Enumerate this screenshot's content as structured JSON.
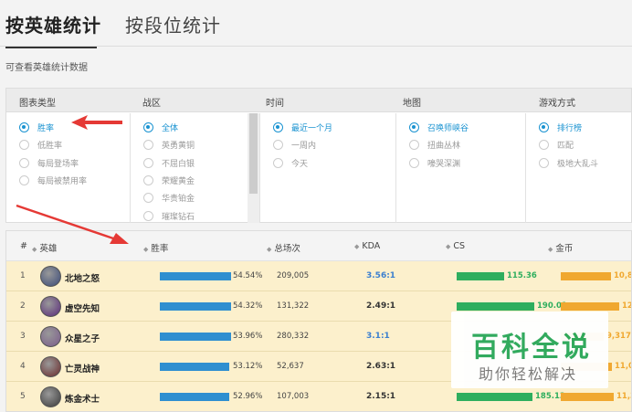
{
  "tabs": [
    "按英雄统计",
    "按段位统计"
  ],
  "description": "可查看英雄统计数据",
  "filters": [
    {
      "header": "图表类型",
      "options": [
        "胜率",
        "低胜率",
        "每局登场率",
        "每局被禁用率"
      ],
      "selected": 0
    },
    {
      "header": "战区",
      "options": [
        "全体",
        "英勇黄铜",
        "不屈白银",
        "荣耀黄金",
        "华贵铂金",
        "璀璨钻石"
      ],
      "selected": 0
    },
    {
      "header": "时间",
      "options": [
        "最近一个月",
        "一周内",
        "今天"
      ],
      "selected": 0
    },
    {
      "header": "地图",
      "options": [
        "召唤师峡谷",
        "扭曲丛林",
        "嚎哭深渊"
      ],
      "selected": 0
    },
    {
      "header": "游戏方式",
      "options": [
        "排行榜",
        "匹配",
        "极地大乱斗"
      ],
      "selected": 0
    }
  ],
  "table": {
    "headers": {
      "rank": "#",
      "hero": "英雄",
      "winrate": "胜率",
      "games": "总场次",
      "kda": "KDA",
      "cs": "CS",
      "gold": "金币"
    },
    "rows": [
      {
        "rank": "1",
        "hero": "北地之怒",
        "winrate": "54.54%",
        "winrate_value": 54.54,
        "games": "209,005",
        "kda": "3.56:1",
        "kda_highlight": true,
        "cs": "115.36",
        "cs_value": 115.36,
        "gold": "10,8",
        "gold_fill": 0.72
      },
      {
        "rank": "2",
        "hero": "虚空先知",
        "winrate": "54.32%",
        "winrate_value": 54.32,
        "games": "131,322",
        "kda": "2.49:1",
        "kda_highlight": false,
        "cs": "190.01",
        "cs_value": 190.01,
        "gold": "12,",
        "gold_fill": 0.84
      },
      {
        "rank": "3",
        "hero": "众星之子",
        "winrate": "53.96%",
        "winrate_value": 53.96,
        "games": "280,332",
        "kda": "3.1:1",
        "kda_highlight": true,
        "cs": "",
        "cs_value": 0,
        "gold": "9,317",
        "gold_fill": 0.62
      },
      {
        "rank": "4",
        "hero": "亡灵战神",
        "winrate": "53.12%",
        "winrate_value": 53.12,
        "games": "52,637",
        "kda": "2.63:1",
        "kda_highlight": false,
        "cs": "",
        "cs_value": 0,
        "gold": "11,0",
        "gold_fill": 0.74
      },
      {
        "rank": "5",
        "hero": "炼金术士",
        "winrate": "52.96%",
        "winrate_value": 52.96,
        "games": "107,003",
        "kda": "2.15:1",
        "kda_highlight": false,
        "cs": "185.13",
        "cs_value": 185.13,
        "gold": "11,3",
        "gold_fill": 0.76
      }
    ]
  },
  "watermark": {
    "title": "百科全说",
    "subtitle": "助你轻松解决"
  },
  "colors": {
    "accent": "#1a93d1",
    "winrate_bar": "#2f8fd0",
    "cs_bar": "#2eae5e",
    "gold_bar": "#f0a830",
    "row_bg": "#fcf0cc",
    "arrow": "#e53935"
  }
}
